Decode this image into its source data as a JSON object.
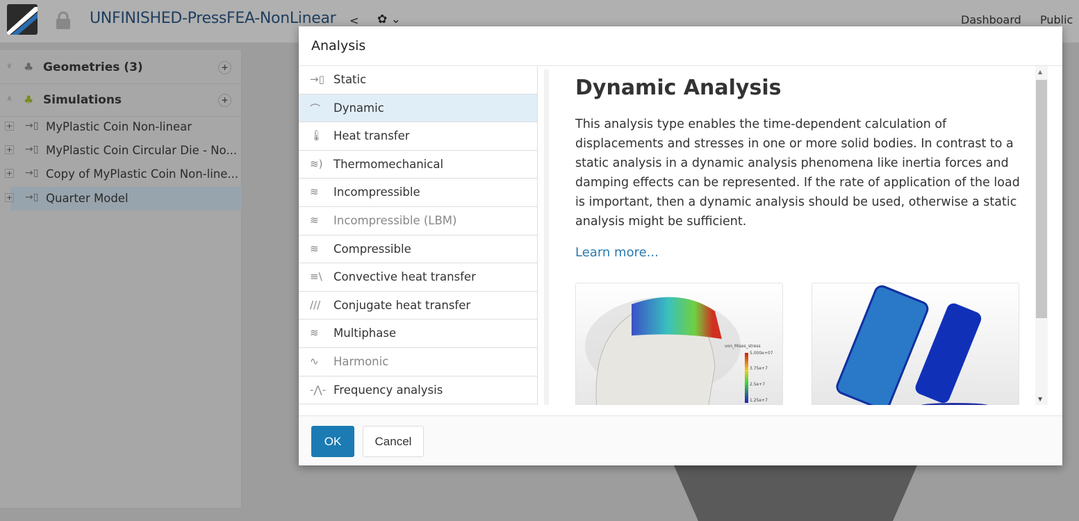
{
  "header": {
    "project_title": "UNFINISHED-PressFEA-NonLinear",
    "nav": [
      "Dashboard",
      "Public P"
    ]
  },
  "sidebar": {
    "geometries": {
      "label": "Geometries (3)"
    },
    "simulations": {
      "label": "Simulations",
      "items": [
        {
          "label": "MyPlastic Coin Non-linear"
        },
        {
          "label": "MyPlastic Coin Circular Die - No..."
        },
        {
          "label": "Copy of MyPlastic Coin Non-line..."
        },
        {
          "label": "Quarter Model"
        }
      ]
    }
  },
  "modal": {
    "title": "Analysis",
    "types": [
      {
        "label": "Static",
        "icon": "→▯"
      },
      {
        "label": "Dynamic",
        "icon": "⌒"
      },
      {
        "label": "Heat transfer",
        "icon": "🌡"
      },
      {
        "label": "Thermomechanical",
        "icon": "≋)"
      },
      {
        "label": "Incompressible",
        "icon": "≋"
      },
      {
        "label": "Incompressible (LBM)",
        "icon": "≋"
      },
      {
        "label": "Compressible",
        "icon": "≋"
      },
      {
        "label": "Convective heat transfer",
        "icon": "≡\\"
      },
      {
        "label": "Conjugate heat transfer",
        "icon": "///"
      },
      {
        "label": "Multiphase",
        "icon": "≋"
      },
      {
        "label": "Harmonic",
        "icon": "∿"
      },
      {
        "label": "Frequency analysis",
        "icon": "-⋀-"
      }
    ],
    "selected": "Dynamic",
    "description": {
      "title": "Dynamic Analysis",
      "text": "This analysis type enables the time-dependent calculation of displacements and stresses in one or more solid bodies. In contrast to a static analysis in a dynamic analysis phenomena like inertia forces and damping effects can be represented. If the rate of application of the load is important, then a dynamic analysis should be used, otherwise a static analysis might be sufficient.",
      "learn_more": "Learn more...",
      "legend": {
        "title": "von_Mises_stress",
        "ticks": [
          "5.000e+07",
          "3.75e+7",
          "2.5e+7",
          "1.25e+7"
        ]
      }
    },
    "ok_label": "OK",
    "cancel_label": "Cancel"
  }
}
